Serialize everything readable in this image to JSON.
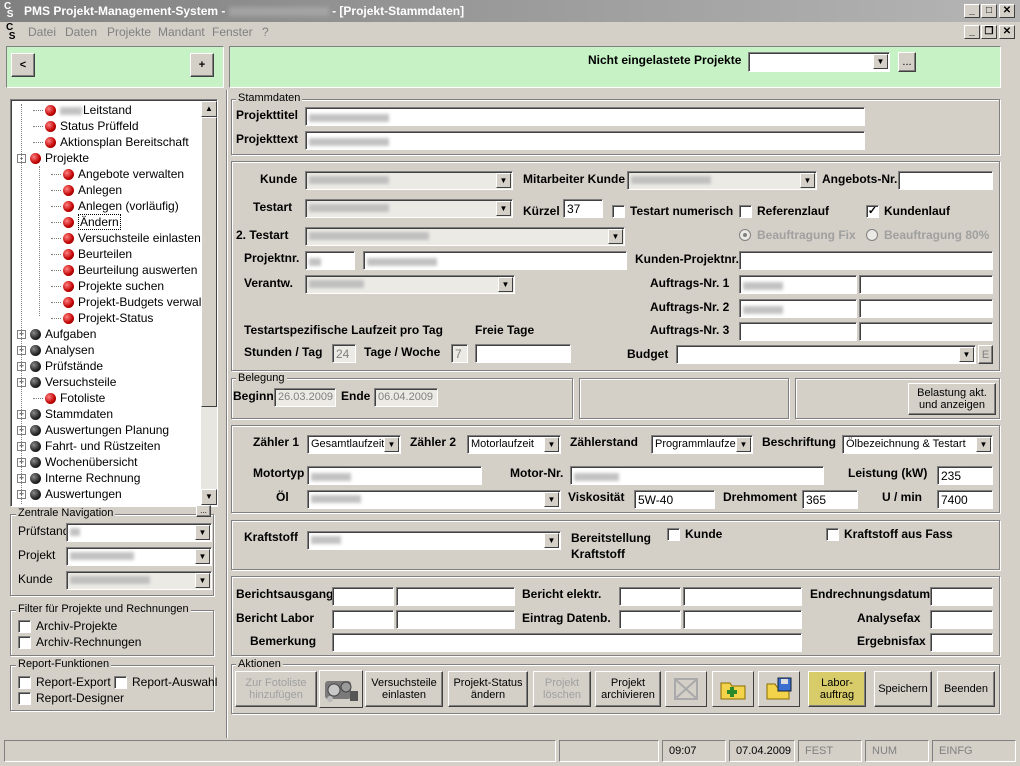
{
  "window": {
    "app_title": "PMS Projekt-Management-System -",
    "user_blurred": "",
    "doc_title": "- [Projekt-Stammdaten]"
  },
  "menu": [
    "Datei",
    "Daten",
    "Projekte",
    "Mandant",
    "Fenster",
    "?"
  ],
  "nav": {
    "back": "<",
    "add": "+"
  },
  "header": {
    "label": "Nicht eingelastete Projekte",
    "more": "..."
  },
  "tree": [
    {
      "label": "Leitstand",
      "level": 1,
      "icon": "red-ball",
      "blur": true
    },
    {
      "label": "Status Prüffeld",
      "level": 1,
      "icon": "red-ball"
    },
    {
      "label": "Aktionsplan Bereitschaft",
      "level": 1,
      "icon": "red-ball"
    },
    {
      "label": "Projekte",
      "level": 0,
      "icon": "red-ball",
      "expander": "-"
    },
    {
      "label": "Angebote verwalten",
      "level": 2,
      "icon": "red-ball"
    },
    {
      "label": "Anlegen",
      "level": 2,
      "icon": "red-ball"
    },
    {
      "label": "Anlegen (vorläufig)",
      "level": 2,
      "icon": "red-ball"
    },
    {
      "label": "Ändern",
      "level": 2,
      "icon": "red-ball",
      "selected": true
    },
    {
      "label": "Versuchsteile einlasten",
      "level": 2,
      "icon": "red-ball"
    },
    {
      "label": "Beurteilen",
      "level": 2,
      "icon": "red-ball"
    },
    {
      "label": "Beurteilung auswerten",
      "level": 2,
      "icon": "red-ball"
    },
    {
      "label": "Projekte suchen",
      "level": 2,
      "icon": "red-ball"
    },
    {
      "label": "Projekt-Budgets verwalten",
      "level": 2,
      "icon": "red-ball"
    },
    {
      "label": "Projekt-Status",
      "level": 2,
      "icon": "red-ball"
    },
    {
      "label": "Aufgaben",
      "level": 0,
      "icon": "dark-ball",
      "expander": "+"
    },
    {
      "label": "Analysen",
      "level": 0,
      "icon": "dark-ball",
      "expander": "+"
    },
    {
      "label": "Prüfstände",
      "level": 0,
      "icon": "dark-ball",
      "expander": "+"
    },
    {
      "label": "Versuchsteile",
      "level": 0,
      "icon": "dark-ball",
      "expander": "+"
    },
    {
      "label": "Fotoliste",
      "level": 1,
      "icon": "red-ball"
    },
    {
      "label": "Stammdaten",
      "level": 0,
      "icon": "dark-ball",
      "expander": "+"
    },
    {
      "label": "Auswertungen Planung",
      "level": 0,
      "icon": "dark-ball",
      "expander": "+"
    },
    {
      "label": "Fahrt- und Rüstzeiten",
      "level": 0,
      "icon": "dark-ball",
      "expander": "+"
    },
    {
      "label": "Wochenübersicht",
      "level": 0,
      "icon": "dark-ball",
      "expander": "+"
    },
    {
      "label": "Interne Rechnung",
      "level": 0,
      "icon": "dark-ball",
      "expander": "+"
    },
    {
      "label": "Auswertungen",
      "level": 0,
      "icon": "dark-ball",
      "expander": "+"
    }
  ],
  "zentrale": {
    "title": "Zentrale Navigation",
    "pruefstand": "Prüfstand",
    "projekt": "Projekt",
    "kunde": "Kunde"
  },
  "filter": {
    "title": "Filter für Projekte und Rechnungen",
    "archiv_projekte": "Archiv-Projekte",
    "archiv_rechnungen": "Archiv-Rechnungen"
  },
  "report": {
    "title": "Report-Funktionen",
    "export": "Report-Export",
    "auswahl": "Report-Auswahl",
    "designer": "Report-Designer"
  },
  "stammdaten": {
    "title": "Stammdaten",
    "projekttitel": "Projekttitel",
    "projekttext": "Projekttext"
  },
  "kunde": {
    "kunde": "Kunde",
    "mitarbeiter": "Mitarbeiter Kunde",
    "angebots_nr": "Angebots-Nr.",
    "testart": "Testart",
    "kuerzel": "Kürzel",
    "kuerzel_value": "37",
    "testart_numerisch": "Testart numerisch",
    "referenzlauf": "Referenzlauf",
    "kundenlauf": "Kundenlauf",
    "kundenlauf_checked": "✓",
    "testart2": "2. Testart",
    "beauftragung_fix": "Beauftragung Fix",
    "beauftragung_80": "Beauftragung 80%",
    "projektnr": "Projektnr.",
    "kunden_projektnr": "Kunden-Projektnr.",
    "verantw": "Verantw.",
    "auftrags1": "Auftrags-Nr. 1",
    "auftrags2": "Auftrags-Nr. 2",
    "auftrags3": "Auftrags-Nr. 3",
    "laufzeit": "Testartspezifische Laufzeit pro Tag",
    "freie_tage": "Freie Tage",
    "stunden_tag": "Stunden / Tag",
    "stunden_tag_value": "24",
    "tage_woche": "Tage / Woche",
    "tage_woche_value": "7",
    "budget": "Budget",
    "budget_btn": "E"
  },
  "belegung": {
    "title": "Belegung",
    "beginn": "Beginn",
    "beginn_value": "26.03.2009",
    "ende": "Ende",
    "ende_value": "06.04.2009",
    "belastung": "Belastung akt. und anzeigen"
  },
  "motor": {
    "zaehler1": "Zähler 1",
    "zaehler1_value": "Gesamtlaufzeit",
    "zaehler2": "Zähler 2",
    "zaehler2_value": "Motorlaufzeit",
    "zaehlerstand": "Zählerstand",
    "zaehlerstand_value": "Programmlaufzeit",
    "beschriftung": "Beschriftung",
    "beschriftung_value": "Ölbezeichnung & Testart",
    "motortyp": "Motortyp",
    "motor_nr": "Motor-Nr.",
    "leistung": "Leistung (kW)",
    "leistung_value": "235",
    "oel": "Öl",
    "viskositaet": "Viskosität",
    "viskositaet_value": "5W-40",
    "drehmoment": "Drehmoment",
    "drehmoment_value": "365",
    "umin": "U / min",
    "umin_value": "7400"
  },
  "kraftstoff": {
    "label": "Kraftstoff",
    "bereitstellung": "Bereitstellung Kraftstoff",
    "kunde": "Kunde",
    "aus_fass": "Kraftstoff aus Fass"
  },
  "bericht": {
    "ausgang": "Berichtsausgang",
    "elektr": "Bericht elektr.",
    "endrechnung": "Endrechnungsdatum",
    "labor": "Bericht Labor",
    "eintrag": "Eintrag Datenb.",
    "analysefax": "Analysefax",
    "bemerkung": "Bemerkung",
    "ergebnisfax": "Ergebnisfax"
  },
  "aktionen": {
    "title": "Aktionen",
    "fotoliste": "Zur Fotoliste hinzufügen",
    "versuchsteile": "Versuchsteile einlasten",
    "status": "Projekt-Status ändern",
    "loeschen": "Projekt löschen",
    "archivieren": "Projekt archivieren",
    "labor": "Labor-auftrag",
    "speichern": "Speichern",
    "beenden": "Beenden"
  },
  "status": {
    "time": "09:07",
    "date": "07.04.2009",
    "fest": "FEST",
    "num": "NUM",
    "einfg": "EINFG"
  }
}
